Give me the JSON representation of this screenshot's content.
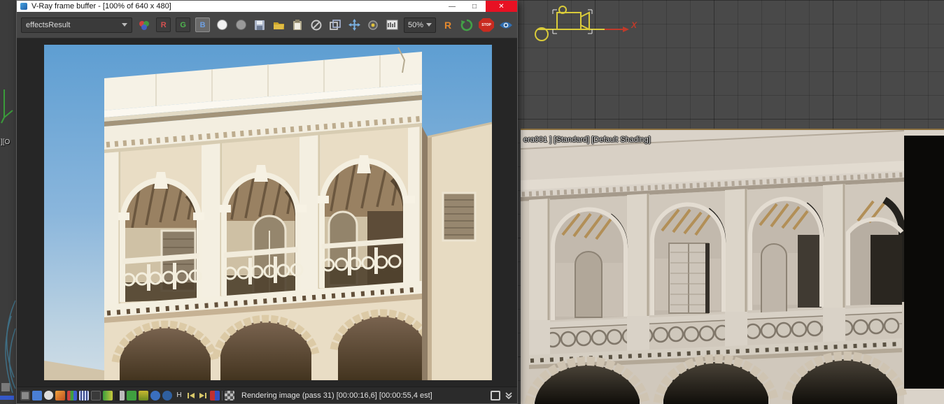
{
  "ui_colors": {
    "titlebar_bg": "#ffffff",
    "close_red": "#e81123",
    "toolbar_bg": "#464646",
    "viewport_grid_bg": "#494949",
    "stop_red": "#c92b20",
    "refresh_green": "#43a047",
    "region_orange": "#e2882f",
    "viewport_highlight_border": "#8a6f3e"
  },
  "vfb": {
    "title": "V-Ray frame buffer - [100% of 640 x 480]",
    "controls": {
      "minimize": "—",
      "maximize": "□",
      "close": "✕"
    },
    "toolbar": {
      "channel_select": "effectsResult",
      "red": "R",
      "green": "G",
      "blue": "B",
      "zoom": "50%",
      "region": "R",
      "stop": "STOP"
    },
    "statusbar": {
      "history": "H",
      "status": "Rendering image (pass 31) [00:00:16,6] [00:00:55,4 est]"
    }
  },
  "viewports": {
    "shaded_label": "era001 ] [Standard] [Default Shading]",
    "axis_x": "X",
    "left_label": "][O"
  }
}
